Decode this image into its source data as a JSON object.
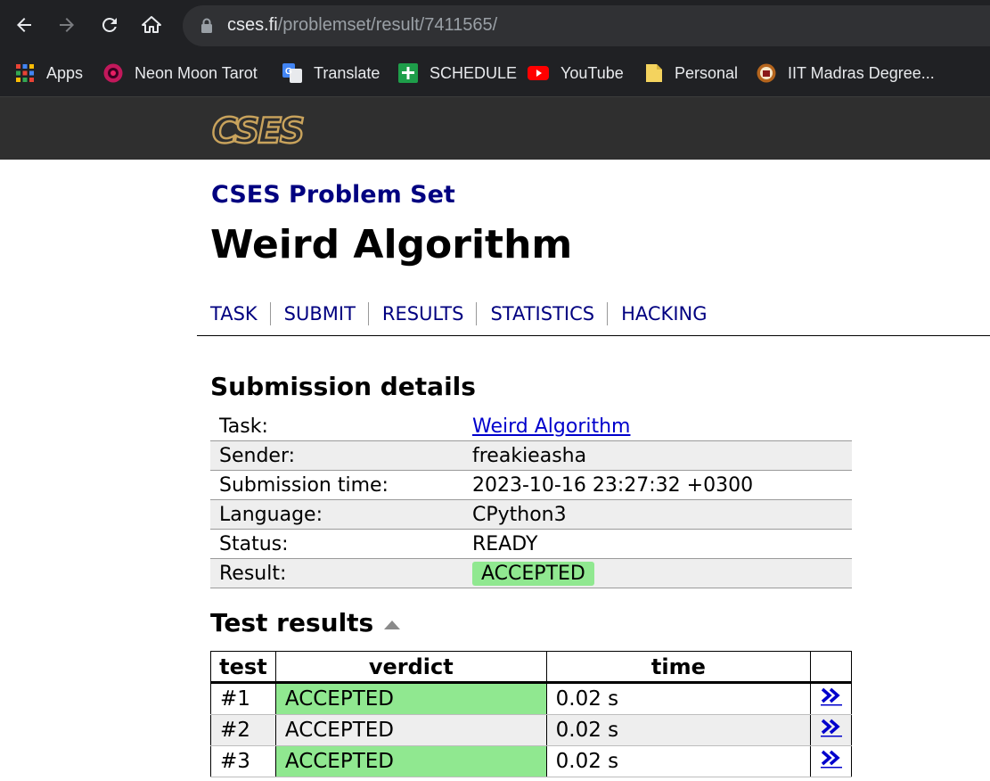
{
  "browser": {
    "url_host": "cses.fi",
    "url_path": "/problemset/result/7411565/",
    "bookmarks": [
      {
        "label": "Apps",
        "icon": "apps-grid-icon"
      },
      {
        "label": "Neon Moon Tarot",
        "icon": "neon-moon-tarot-icon"
      },
      {
        "label": "Translate",
        "icon": "google-translate-icon"
      },
      {
        "label": "SCHEDULE",
        "icon": "sheets-icon"
      },
      {
        "label": "YouTube",
        "icon": "youtube-icon"
      },
      {
        "label": "Personal",
        "icon": "folder-icon"
      },
      {
        "label": "IIT Madras Degree...",
        "icon": "iitm-icon"
      }
    ]
  },
  "site": {
    "logo_text": "CSES",
    "problem_set_title": "CSES Problem Set",
    "problem_title": "Weird Algorithm",
    "nav": [
      "TASK",
      "SUBMIT",
      "RESULTS",
      "STATISTICS",
      "HACKING"
    ]
  },
  "submission": {
    "heading": "Submission details",
    "rows": [
      {
        "key": "Task:",
        "value": "Weird Algorithm"
      },
      {
        "key": "Sender:",
        "value": "freakieasha"
      },
      {
        "key": "Submission time:",
        "value": "2023-10-16 23:27:32 +0300"
      },
      {
        "key": "Language:",
        "value": "CPython3"
      },
      {
        "key": "Status:",
        "value": "READY"
      },
      {
        "key": "Result:",
        "value": "ACCEPTED"
      }
    ]
  },
  "tests": {
    "heading": "Test results",
    "columns": [
      "test",
      "verdict",
      "time",
      ""
    ],
    "rows": [
      {
        "test": "#1",
        "verdict": "ACCEPTED",
        "time": "0.02 s",
        "link": "»"
      },
      {
        "test": "#2",
        "verdict": "ACCEPTED",
        "time": "0.02 s",
        "link": "»"
      },
      {
        "test": "#3",
        "verdict": "ACCEPTED",
        "time": "0.02 s",
        "link": "»"
      }
    ]
  },
  "colors": {
    "chrome_bg": "#202124",
    "header_bg": "#2f2f2f",
    "link_navy": "#000080",
    "accepted_green": "#90e890",
    "row_alt": "#eeeeee"
  }
}
